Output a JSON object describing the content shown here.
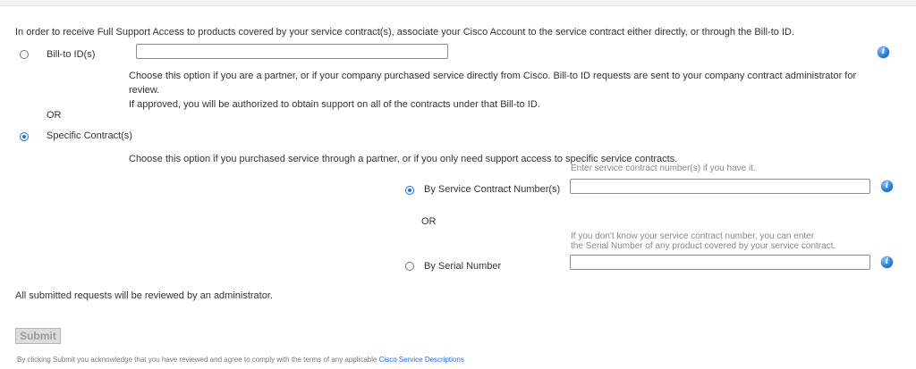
{
  "intro": "In order to receive Full Support Access to products covered by your service contract(s), associate your Cisco Account to the service contract either directly, or through the Bill-to ID.",
  "bill_to": {
    "label": "Bill-to ID(s)",
    "value": "",
    "selected": false,
    "description_line1": "Choose this option if you are a partner, or if your company purchased service directly from Cisco. Bill-to ID requests are sent to your company contract administrator for review.",
    "description_line2": "If approved, you will be authorized to obtain support on all of the contracts under that Bill-to ID."
  },
  "or_label": "OR",
  "specific": {
    "label": "Specific Contract(s)",
    "selected": true,
    "description": "Choose this option if you purchased service through a partner, or if you only need support access to specific service contracts.",
    "contract_number": {
      "label": "By Service Contract Number(s)",
      "hint": "Enter service contract number(s) if you have it.",
      "value": "",
      "selected": true
    },
    "inner_or": "OR",
    "serial_number": {
      "label": "By Serial Number",
      "hint_line1": "If you don't know your service contract number, you can enter",
      "hint_line2": "the Serial Number of any product covered by your service contract.",
      "value": "",
      "selected": false
    }
  },
  "info_icon_glyph": "i",
  "review_note": "All submitted requests will be reviewed by an administrator.",
  "submit_label": "Submit",
  "footnote": {
    "text": "By clicking Submit you acknowledge that you have reviewed and agree to comply with the terms of any applicable",
    "link_text": "Cisco Service Descriptions"
  },
  "colors": {
    "accent": "#1a73e8",
    "info_icon": "#2a7fd6",
    "button_bg": "#dcdcdc"
  }
}
